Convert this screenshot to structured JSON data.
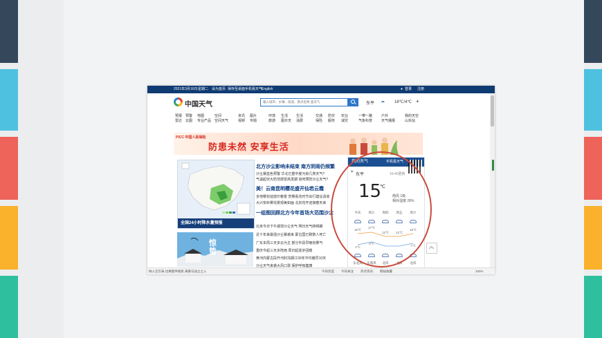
{
  "colors": {
    "navy_block": "#35475a",
    "cyan_block": "#4fc1e0",
    "red_block": "#ee635a",
    "orange_block": "#fab12c",
    "teal_block": "#2ebf9f",
    "accent_circle": "#c94a3c",
    "site_blue": "#0f3b73"
  },
  "topbar": {
    "date": "2021年3月16日",
    "weekday": "星期二",
    "set_home": "设为首页",
    "favorite": "保存至桌面",
    "mobile": "手机看天气",
    "english": "English",
    "login": "登录",
    "register": "注册"
  },
  "header": {
    "logo": "中国天气",
    "search_placeholder": "输入城市、乡镇、街道、景点名称 查天气",
    "city": "东平",
    "temp": "16℃/4℃",
    "plus": "+"
  },
  "nav": [
    "预报\n雷达",
    "预警\n云图",
    "地图\n专业产品",
    "空间\n空间天气",
    "资讯\n视频",
    "图片\n专题",
    "环境\n旅游",
    "生活\n图示天",
    "生活\n消费",
    "交通\n保险",
    "防灾\n服务",
    "农业\n减灾",
    "一带一路\n气象科普",
    "户外\n天气播报",
    "我的天空\n山东站"
  ],
  "banner": {
    "logo": "PICC 中国人民保险",
    "slogan": "防患未然  安享生活"
  },
  "map_card": {
    "caption": "全国24小时降水量预报"
  },
  "solar_card": {
    "term": "惊蛰"
  },
  "news": [
    "北方沙尘影响未结束 南方阴雨仍频繁",
    "沙尘暴蓝色预警 华北已重中度污染几类天气?",
    "气温起伏大防范感冒高发期 如何预防沙尘天气?",
    "美！云南昆明樱花盛开仙若云霞",
    "多地樱花绽放印春景 赏樱看花时节出行建议请收",
    "大兴安岭雾凇景观美如画 北京花开迎接春天来",
    "一组图回顾北方今年首场大范围沙尘",
    "北京今日下午或现沙尘天气 明日天气转晴朗",
    "近十年来最强沙尘暴袭来 蒙古国已致数人死亡",
    "广东本周三天多云为主 部分市县早晚有雾气",
    "重庆今起三天多阵雨 周日起逐步回暖",
    "黄河内蒙古段开河封冻期江30年平均偏早10天",
    "沙尘天气来袭大风口罩 保护呼吸健康"
  ],
  "weather_panel": {
    "title": "我的天气",
    "subtitle": "手机看天气",
    "city": "东平",
    "updated": "16:40更新",
    "temp_now": "15",
    "unit": "℃",
    "wind": "南风 1级",
    "humidity": "相对湿度 28%",
    "days": [
      "今天",
      "周三",
      "周四",
      "周五",
      "周六"
    ],
    "highs": [
      "16℃",
      "17℃",
      "12℃",
      "12℃",
      "16℃"
    ],
    "lows": [
      "4℃",
      "8℃",
      "",
      "",
      "7℃"
    ],
    "winds": [
      "东北风",
      "东南风",
      "北风",
      "北风",
      "北风"
    ]
  },
  "statusbar": {
    "left": "纳入云页采,也换图件搜索,来路与加立之入",
    "items": [
      "今日优选",
      "今日关注",
      "热点资讯",
      "网站收藏"
    ],
    "zoom": "100%"
  }
}
